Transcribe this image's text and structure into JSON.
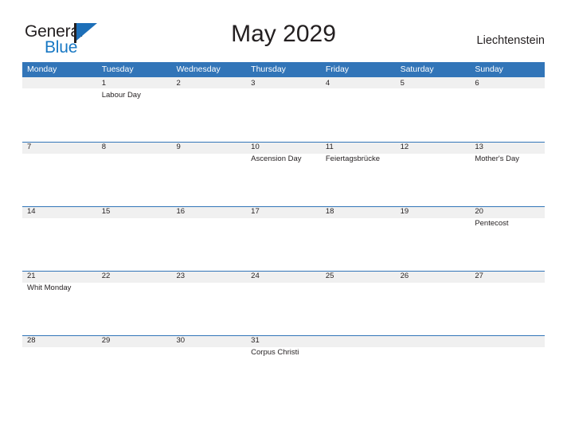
{
  "brand": {
    "name_part1": "General",
    "name_part2": "Blue",
    "flag_color": "#1d6fb8"
  },
  "header": {
    "title": "May 2029",
    "country": "Liechtenstein",
    "accent_color": "#3275b8",
    "band_color": "#f0f0f0"
  },
  "calendar": {
    "weekdays": [
      "Monday",
      "Tuesday",
      "Wednesday",
      "Thursday",
      "Friday",
      "Saturday",
      "Sunday"
    ],
    "weeks": [
      {
        "days": [
          {
            "num": "",
            "event": ""
          },
          {
            "num": "1",
            "event": "Labour Day"
          },
          {
            "num": "2",
            "event": ""
          },
          {
            "num": "3",
            "event": ""
          },
          {
            "num": "4",
            "event": ""
          },
          {
            "num": "5",
            "event": ""
          },
          {
            "num": "6",
            "event": ""
          }
        ]
      },
      {
        "days": [
          {
            "num": "7",
            "event": ""
          },
          {
            "num": "8",
            "event": ""
          },
          {
            "num": "9",
            "event": ""
          },
          {
            "num": "10",
            "event": "Ascension Day"
          },
          {
            "num": "11",
            "event": "Feiertagsbrücke"
          },
          {
            "num": "12",
            "event": ""
          },
          {
            "num": "13",
            "event": "Mother's Day"
          }
        ]
      },
      {
        "days": [
          {
            "num": "14",
            "event": ""
          },
          {
            "num": "15",
            "event": ""
          },
          {
            "num": "16",
            "event": ""
          },
          {
            "num": "17",
            "event": ""
          },
          {
            "num": "18",
            "event": ""
          },
          {
            "num": "19",
            "event": ""
          },
          {
            "num": "20",
            "event": "Pentecost"
          }
        ]
      },
      {
        "days": [
          {
            "num": "21",
            "event": "Whit Monday"
          },
          {
            "num": "22",
            "event": ""
          },
          {
            "num": "23",
            "event": ""
          },
          {
            "num": "24",
            "event": ""
          },
          {
            "num": "25",
            "event": ""
          },
          {
            "num": "26",
            "event": ""
          },
          {
            "num": "27",
            "event": ""
          }
        ]
      },
      {
        "days": [
          {
            "num": "28",
            "event": ""
          },
          {
            "num": "29",
            "event": ""
          },
          {
            "num": "30",
            "event": ""
          },
          {
            "num": "31",
            "event": "Corpus Christi"
          },
          {
            "num": "",
            "event": ""
          },
          {
            "num": "",
            "event": ""
          },
          {
            "num": "",
            "event": ""
          }
        ]
      }
    ]
  }
}
